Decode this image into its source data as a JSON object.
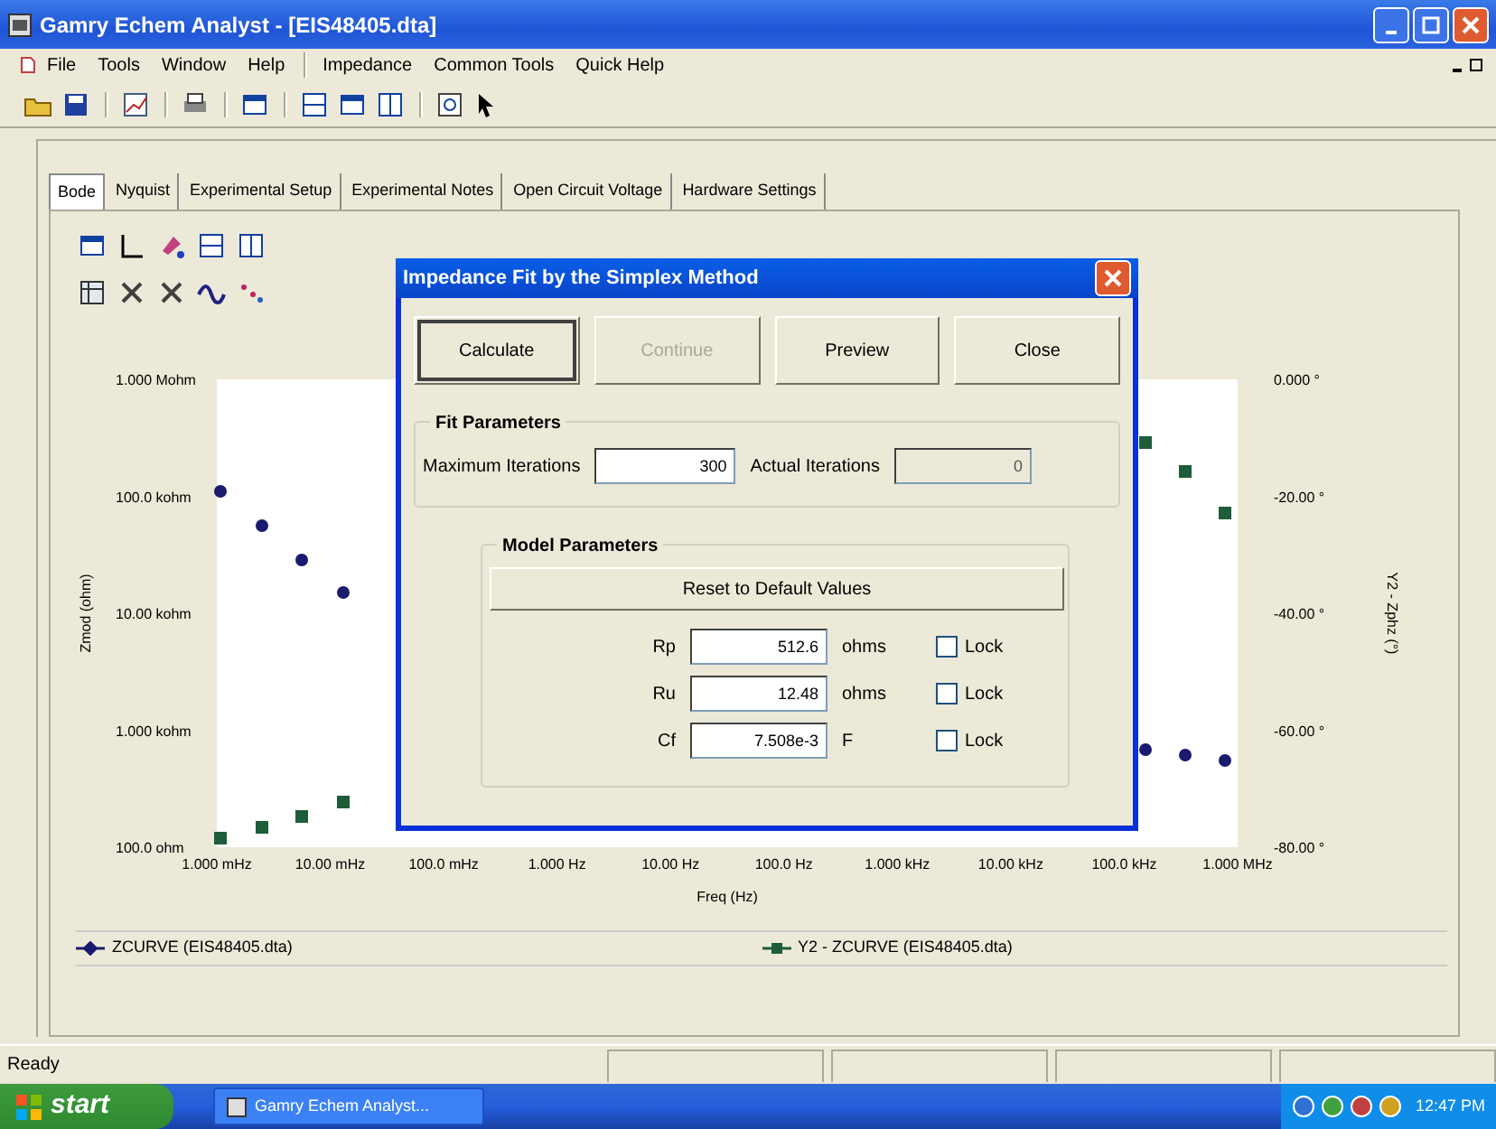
{
  "window": {
    "title": "Gamry Echem Analyst - [EIS48405.dta]"
  },
  "menu_groups": [
    [
      "File",
      "Tools",
      "Window",
      "Help"
    ],
    [
      "Impedance",
      "Common Tools",
      "Quick Help"
    ]
  ],
  "tabs": [
    {
      "label": "Bode",
      "selected": true
    },
    {
      "label": "Nyquist",
      "selected": false
    },
    {
      "label": "Experimental Setup",
      "selected": false
    },
    {
      "label": "Experimental Notes",
      "selected": false
    },
    {
      "label": "Open Circuit Voltage",
      "selected": false
    },
    {
      "label": "Hardware Settings",
      "selected": false
    }
  ],
  "chart": {
    "xlabel": "Freq (Hz)",
    "ylabel": "Zmod (ohm)",
    "y2label": "Y2 - Zphz (°)",
    "x_axis_labels": [
      "1.000 mHz",
      "10.00 mHz",
      "100.0 mHz",
      "1.000 Hz",
      "10.00 Hz",
      "100.0 Hz",
      "1.000 kHz",
      "10.00 kHz",
      "100.0 kHz",
      "1.000 MHz"
    ],
    "y_axis_labels": [
      "1.000 Mohm",
      "100.0 kohm",
      "10.00 kohm",
      "1.000 kohm",
      "100.0 ohm"
    ],
    "y2_axis_labels": [
      "0.000 °",
      "-20.00 °",
      "-40.00 °",
      "-60.00 °",
      "-80.00 °"
    ],
    "legend": [
      {
        "label": "ZCURVE (EIS48405.dta)",
        "color": "#1a1a6e",
        "kind": "diamond"
      },
      {
        "label": "Y2 - ZCURVE (EIS48405.dta)",
        "color": "#1e5c3a",
        "kind": "square"
      }
    ]
  },
  "dialog": {
    "title": "Impedance Fit by the Simplex Method",
    "buttons": [
      {
        "label": "Calculate",
        "default": true,
        "disabled": false
      },
      {
        "label": "Continue",
        "default": false,
        "disabled": true
      },
      {
        "label": "Preview",
        "default": false,
        "disabled": false
      },
      {
        "label": "Close",
        "default": false,
        "disabled": false
      }
    ],
    "fit_parameters": {
      "title": "Fit Parameters",
      "fields": [
        {
          "label": "Maximum Iterations",
          "value": "300",
          "disabled": false
        },
        {
          "label": "Actual Iterations",
          "value": "0",
          "disabled": true
        }
      ]
    },
    "model_parameters": {
      "title": "Model Parameters",
      "reset_button": "Reset to Default Values",
      "rows": [
        {
          "name": "Rp",
          "value": "512.6",
          "unit": "ohms",
          "lock_label": "Lock",
          "checked": false
        },
        {
          "name": "Ru",
          "value": "12.48",
          "unit": "ohms",
          "lock_label": "Lock",
          "checked": false
        },
        {
          "name": "Cf",
          "value": "7.508e-3",
          "unit": "F",
          "lock_label": "Lock",
          "checked": false
        }
      ]
    }
  },
  "status_bar": {
    "text": "Ready"
  },
  "taskbar": {
    "start": "start",
    "tasks": [
      {
        "label": "Gamry Echem Analyst...",
        "selected": false
      }
    ],
    "clock": "12:47 PM"
  }
}
